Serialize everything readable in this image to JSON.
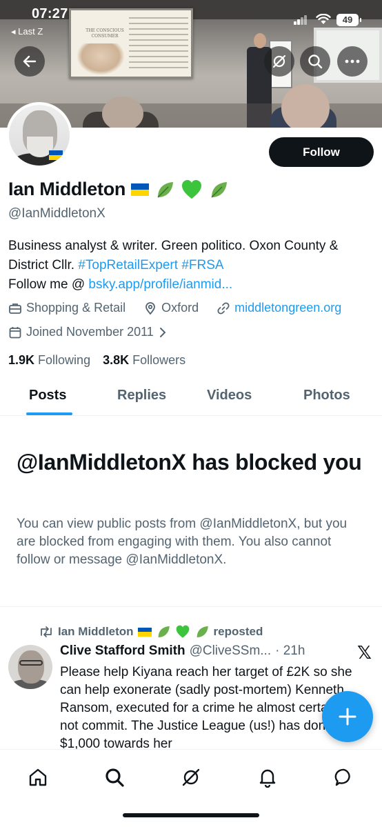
{
  "status_bar": {
    "time": "07:27",
    "back_label": "◂ Last Z",
    "battery": "49"
  },
  "banner": {
    "screen_title": "THE CONSCIOUS CONSUMER"
  },
  "header_buttons": {
    "back_icon": "back-arrow-icon",
    "grok_icon": "grok-icon",
    "search_icon": "search-icon",
    "more_icon": "more-icon"
  },
  "profile": {
    "follow_label": "Follow",
    "name": "Ian Middleton",
    "handle": "@IanMiddletonX",
    "bio_text_1": "Business analyst & writer. Green politico. Oxon County & District Cllr. ",
    "bio_tag_1": "#TopRetailExpert",
    "bio_tag_2": "#FRSA",
    "bio_follow_prefix": "Follow me @ ",
    "bio_link": "bsky.app/profile/ianmid...",
    "category": "Shopping & Retail",
    "location": "Oxford",
    "website": "middletongreen.org",
    "joined": "Joined November 2011",
    "following_count": "1.9K",
    "following_label": "Following",
    "followers_count": "3.8K",
    "followers_label": "Followers"
  },
  "tabs": [
    {
      "label": "Posts"
    },
    {
      "label": "Replies"
    },
    {
      "label": "Videos"
    },
    {
      "label": "Photos"
    }
  ],
  "blocked": {
    "title": "@IanMiddletonX has blocked you",
    "message": "You can view public posts from @IanMiddletonX, but you are blocked from engaging with them. You also cannot follow or message @IanMiddletonX."
  },
  "post": {
    "repost_by": "Ian Middleton",
    "repost_label": "reposted",
    "author": "Clive Stafford Smith",
    "handle": "@CliveSSm...",
    "time": "· 21h",
    "text": "Please help Kiyana reach her target of £2K so she can help exonerate (sadly post-mortem) Kenneth Ransom, executed for a crime he almost certainly did not commit. The Justice League (us!) has donated $1,000 towards her"
  },
  "colors": {
    "accent": "#1d9bf0",
    "text_primary": "#0f1419",
    "text_secondary": "#536471"
  }
}
